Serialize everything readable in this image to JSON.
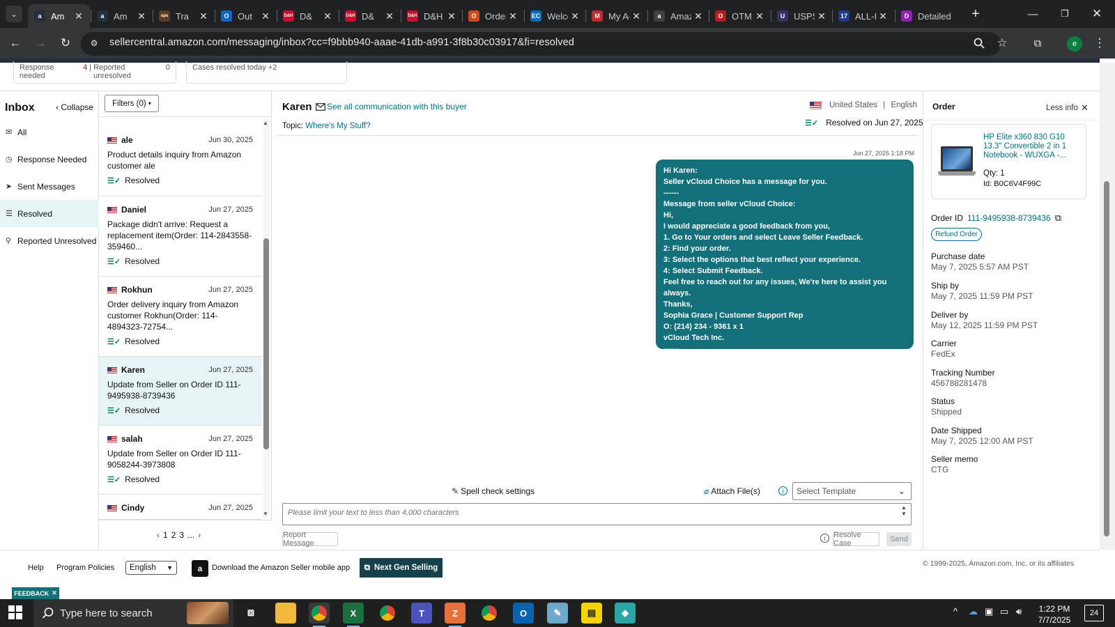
{
  "browser": {
    "tabs": [
      {
        "label": "Am",
        "fav": "a",
        "color": "#232f3e"
      },
      {
        "label": "Am",
        "fav": "a",
        "color": "#232f3e"
      },
      {
        "label": "Tra",
        "fav": "ups",
        "color": "#5c3b1f"
      },
      {
        "label": "Out",
        "fav": "O",
        "color": "#1565c0"
      },
      {
        "label": "D&",
        "fav": "D&H",
        "color": "#c8102e"
      },
      {
        "label": "D&",
        "fav": "D&H",
        "color": "#c8102e"
      },
      {
        "label": "D&H Di",
        "fav": "D&H",
        "color": "#c8102e"
      },
      {
        "label": "Orders",
        "fav": "O",
        "color": "#d04a1f"
      },
      {
        "label": "Welcom",
        "fav": "EC",
        "color": "#0b6bb3"
      },
      {
        "label": "My Acc",
        "fav": "M",
        "color": "#c62828"
      },
      {
        "label": "Amazon",
        "fav": "a",
        "color": "#3c4043"
      },
      {
        "label": "OTMS",
        "fav": "O",
        "color": "#b71c1c"
      },
      {
        "label": "USPS.co",
        "fav": "U",
        "color": "#333366"
      },
      {
        "label": "ALL-IN-",
        "fav": "17",
        "color": "#1e3a8a"
      },
      {
        "label": "Detailed",
        "fav": "D",
        "color": "#8e24aa"
      }
    ],
    "url": "sellercentral.amazon.com/messaging/inbox?cc=f9bbb940-aaae-41db-a991-3f8b30c03917&fi=resolved",
    "profile_initial": "e"
  },
  "top_summary": {
    "response_needed_label": "Response needed",
    "response_needed_count": "4",
    "reported_unresolved_label": "Reported unresolved",
    "reported_unresolved_count": "0",
    "cases_resolved_label": "Cases resolved today",
    "cases_resolved_count": "+2"
  },
  "inbox": {
    "title": "Inbox",
    "collapse_label": "Collapse",
    "nav": [
      {
        "label": "All",
        "icon": "mail-icon"
      },
      {
        "label": "Response Needed",
        "icon": "clock-icon"
      },
      {
        "label": "Sent Messages",
        "icon": "send-icon"
      },
      {
        "label": "Resolved",
        "icon": "resolved-icon"
      },
      {
        "label": "Reported Unresolved",
        "icon": "user-report-icon"
      }
    ],
    "filters_label": "Filters (0)",
    "conversations": [
      {
        "name": "ale",
        "date": "Jun 30, 2025",
        "subject": "Product details inquiry from Amazon customer ale",
        "status": "Resolved"
      },
      {
        "name": "Daniel",
        "date": "Jun 27, 2025",
        "subject": "Package didn't arrive: Request a replacement item(Order: 114-2843558-359460...",
        "status": "Resolved"
      },
      {
        "name": "Rokhun",
        "date": "Jun 27, 2025",
        "subject": "Order delivery inquiry from Amazon customer Rokhun(Order: 114-4894323-72754...",
        "status": "Resolved"
      },
      {
        "name": "Karen",
        "date": "Jun 27, 2025",
        "subject": "Update from Seller on Order ID 111-9495938-8739436",
        "status": "Resolved"
      },
      {
        "name": "salah",
        "date": "Jun 27, 2025",
        "subject": "Update from Seller on Order ID 111-9058244-3973808",
        "status": "Resolved"
      },
      {
        "name": "Cindy",
        "date": "Jun 27, 2025",
        "subject": "",
        "status": ""
      }
    ],
    "pager": {
      "pages": [
        "1",
        "2",
        "3",
        "..."
      ]
    }
  },
  "thread": {
    "buyer": "Karen",
    "see_all": "See all communication with this buyer",
    "topic_label": "Topic:",
    "topic_value": "Where's My Stuff?",
    "country": "United States",
    "language": "English",
    "resolved_on": "Resolved on Jun 27, 2025",
    "message_time": "Jun 27, 2025 1:18 PM",
    "message_lines": [
      "Hi Karen:",
      "Seller vCloud Choice has a message for you.",
      "------",
      "Message from seller vCloud Choice:",
      "Hi,",
      "I would appreciate a good feedback from you,",
      "1. Go to Your orders and select Leave Seller Feedback.",
      "2: Find your order.",
      "3: Select the options that best reflect your experience.",
      "4: Select Submit Feedback.",
      "Feel free to reach out for any issues, We're here to assist you always.",
      "Thanks,",
      "Sophia Grace | Customer Support Rep",
      "O: (214) 234 - 9361 x 1",
      "vCloud Tech Inc.",
      "------"
    ],
    "spell_check": "Spell check settings",
    "attach": "Attach File(s)",
    "template_placeholder": "Select Template",
    "reply_placeholder": "Please limit your text to less than 4,000 characters",
    "report_btn": "Report Message",
    "resolve_btn": "Resolve Case",
    "send_btn": "Send"
  },
  "order": {
    "heading": "Order",
    "less_info": "Less info",
    "product_title": "HP Elite x360 830 G10 13.3\" Convertible 2 in 1 Notebook - WUXGA -...",
    "qty": "Qty: 1",
    "asin": "Id: B0C6V4F99C",
    "order_id_label": "Order ID",
    "order_id": "111-9495938-8739436",
    "refund_btn": "Refund Order",
    "fields": [
      {
        "label": "Purchase date",
        "value": "May 7, 2025 5:57 AM PST"
      },
      {
        "label": "Ship by",
        "value": "May 7, 2025 11:59 PM PST"
      },
      {
        "label": "Deliver by",
        "value": "May 12, 2025 11:59 PM PST"
      },
      {
        "label": "Carrier",
        "value": "FedEx"
      },
      {
        "label": "Tracking Number",
        "value": "456788281478"
      },
      {
        "label": "Status",
        "value": "Shipped"
      },
      {
        "label": "Date Shipped",
        "value": "May 7, 2025 12:00 AM PST"
      },
      {
        "label": "Seller memo",
        "value": "CTG"
      }
    ]
  },
  "footer": {
    "help": "Help",
    "policies": "Program Policies",
    "language": "English",
    "app_download": "Download the Amazon Seller mobile app",
    "next_gen": "Next Gen Selling",
    "copyright": "© 1999-2025, Amazon.com, Inc. or its affiliates",
    "feedback": "FEEDBACK"
  },
  "taskbar": {
    "search_placeholder": "Type here to search",
    "time": "1:22 PM",
    "date": "7/7/2025",
    "notification_count": "24"
  }
}
